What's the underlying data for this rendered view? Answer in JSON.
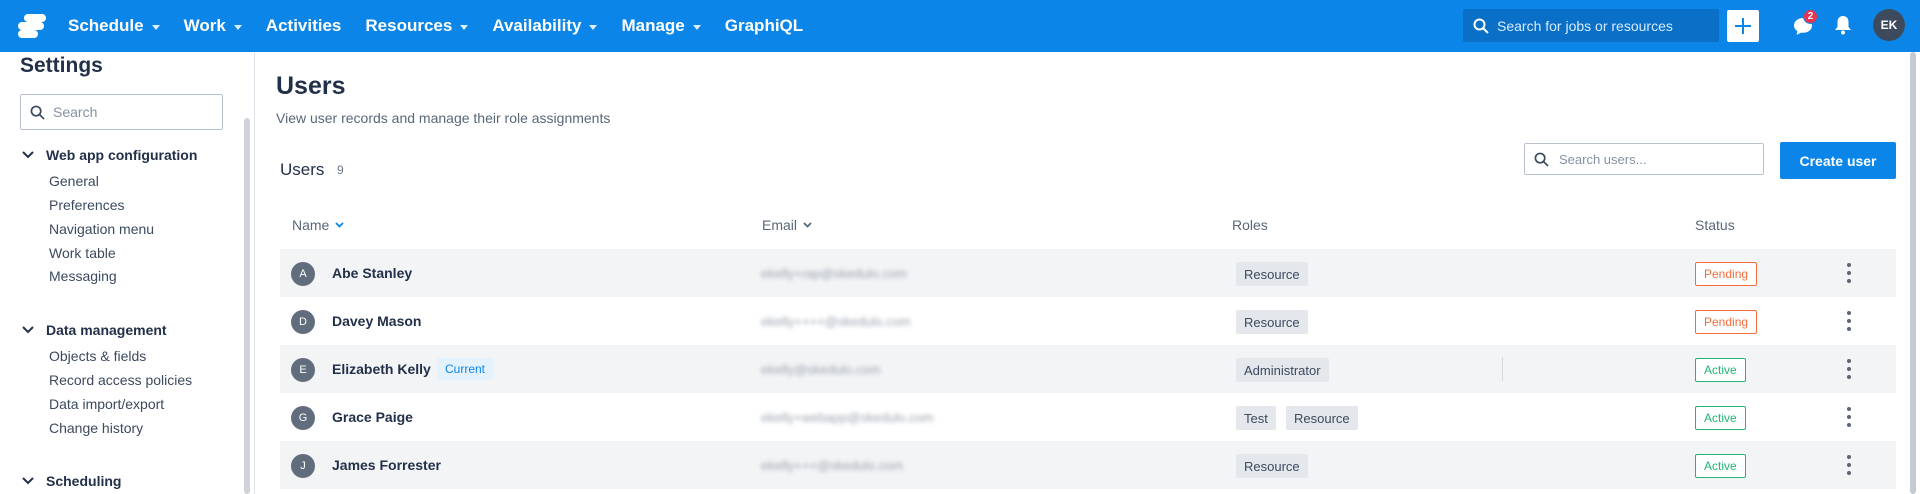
{
  "topnav": {
    "menu": [
      {
        "label": "Schedule",
        "dropdown": true
      },
      {
        "label": "Work",
        "dropdown": true
      },
      {
        "label": "Activities",
        "dropdown": false
      },
      {
        "label": "Resources",
        "dropdown": true
      },
      {
        "label": "Availability",
        "dropdown": true
      },
      {
        "label": "Manage",
        "dropdown": true
      },
      {
        "label": "GraphiQL",
        "dropdown": false
      }
    ],
    "search_placeholder": "Search for jobs or resources",
    "notification_count": "2",
    "user_initials": "EK"
  },
  "sidebar": {
    "title": "Settings",
    "search_placeholder": "Search",
    "groups": [
      {
        "label": "Web app configuration",
        "items": [
          "General",
          "Preferences",
          "Navigation menu",
          "Work table",
          "Messaging"
        ]
      },
      {
        "label": "Data management",
        "items": [
          "Objects & fields",
          "Record access policies",
          "Data import/export",
          "Change history"
        ]
      },
      {
        "label": "Scheduling",
        "items": []
      }
    ]
  },
  "main": {
    "title": "Users",
    "subtitle": "View user records and manage their role assignments",
    "users_label": "Users",
    "users_count": "9",
    "search_placeholder": "Search users...",
    "create_button": "Create user",
    "columns": {
      "name": "Name",
      "email": "Email",
      "roles": "Roles",
      "status": "Status"
    },
    "rows": [
      {
        "initial": "A",
        "name": "Abe Stanley",
        "current": "",
        "email": "ekelly+rap@skedulo.com",
        "roles": [
          "Resource"
        ],
        "status": "Pending"
      },
      {
        "initial": "D",
        "name": "Davey Mason",
        "current": "",
        "email": "ekelly++++@skedulo.com",
        "roles": [
          "Resource"
        ],
        "status": "Pending"
      },
      {
        "initial": "E",
        "name": "Elizabeth Kelly",
        "current": "Current",
        "email": "ekelly@skedulo.com",
        "roles": [
          "Administrator"
        ],
        "status": "Active"
      },
      {
        "initial": "G",
        "name": "Grace Paige",
        "current": "",
        "email": "ekelly+webapp@skedulo.com",
        "roles": [
          "Test",
          "Resource"
        ],
        "status": "Active"
      },
      {
        "initial": "J",
        "name": "James Forrester",
        "current": "",
        "email": "ekelly+++@skedulo.com",
        "roles": [
          "Resource"
        ],
        "status": "Active"
      }
    ]
  },
  "colors": {
    "brand": "#0b86e8",
    "pending": "#f26d3d",
    "active": "#22b573"
  }
}
